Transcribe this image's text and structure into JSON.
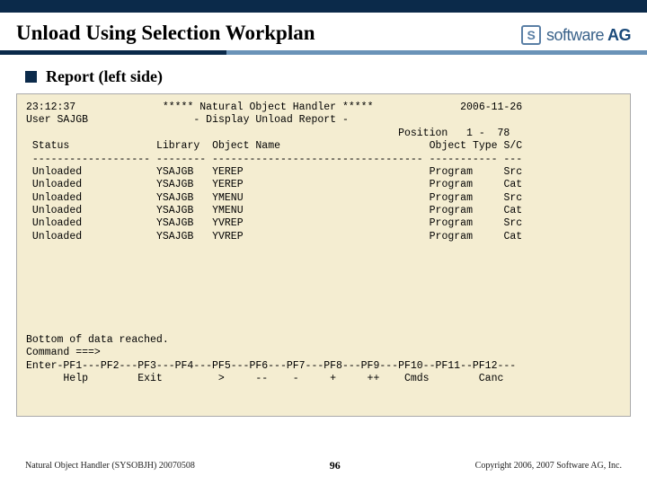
{
  "slide": {
    "title": "Unload Using Selection Workplan",
    "subhead": "Report (left side)"
  },
  "logo": {
    "text_light": "software",
    "text_bold": "AG",
    "mark": "S"
  },
  "terminal": {
    "time": "23:12:37",
    "banner": "***** Natural Object Handler *****",
    "date": "2006-11-26",
    "user_label": "User",
    "user": "SAJGB",
    "subtitle": "- Display Unload Report -",
    "position_label": "Position",
    "position_range": "1 -  78",
    "headers": {
      "status": "Status",
      "library": "Library",
      "object": "Object Name",
      "objtype": "Object Type",
      "sc": "S/C"
    },
    "rows": [
      {
        "status": "Unloaded",
        "library": "YSAJGB",
        "object": "YEREP",
        "objtype": "Program",
        "sc": "Src"
      },
      {
        "status": "Unloaded",
        "library": "YSAJGB",
        "object": "YEREP",
        "objtype": "Program",
        "sc": "Cat"
      },
      {
        "status": "Unloaded",
        "library": "YSAJGB",
        "object": "YMENU",
        "objtype": "Program",
        "sc": "Src"
      },
      {
        "status": "Unloaded",
        "library": "YSAJGB",
        "object": "YMENU",
        "objtype": "Program",
        "sc": "Cat"
      },
      {
        "status": "Unloaded",
        "library": "YSAJGB",
        "object": "YVREP",
        "objtype": "Program",
        "sc": "Src"
      },
      {
        "status": "Unloaded",
        "library": "YSAJGB",
        "object": "YVREP",
        "objtype": "Program",
        "sc": "Cat"
      }
    ],
    "bottom_msg": "Bottom of data reached.",
    "command_label": "Command ===>",
    "pf_line1": "Enter-PF1---PF2---PF3---PF4---PF5---PF6---PF7---PF8---PF9---PF10--PF11--PF12---",
    "pf_line2": "      Help        Exit         >     --    -     +     ++    Cmds        Canc"
  },
  "footer": {
    "left": "Natural Object Handler (SYSOBJH) 20070508",
    "page": "96",
    "right": "Copyright 2006, 2007 Software AG, Inc."
  }
}
